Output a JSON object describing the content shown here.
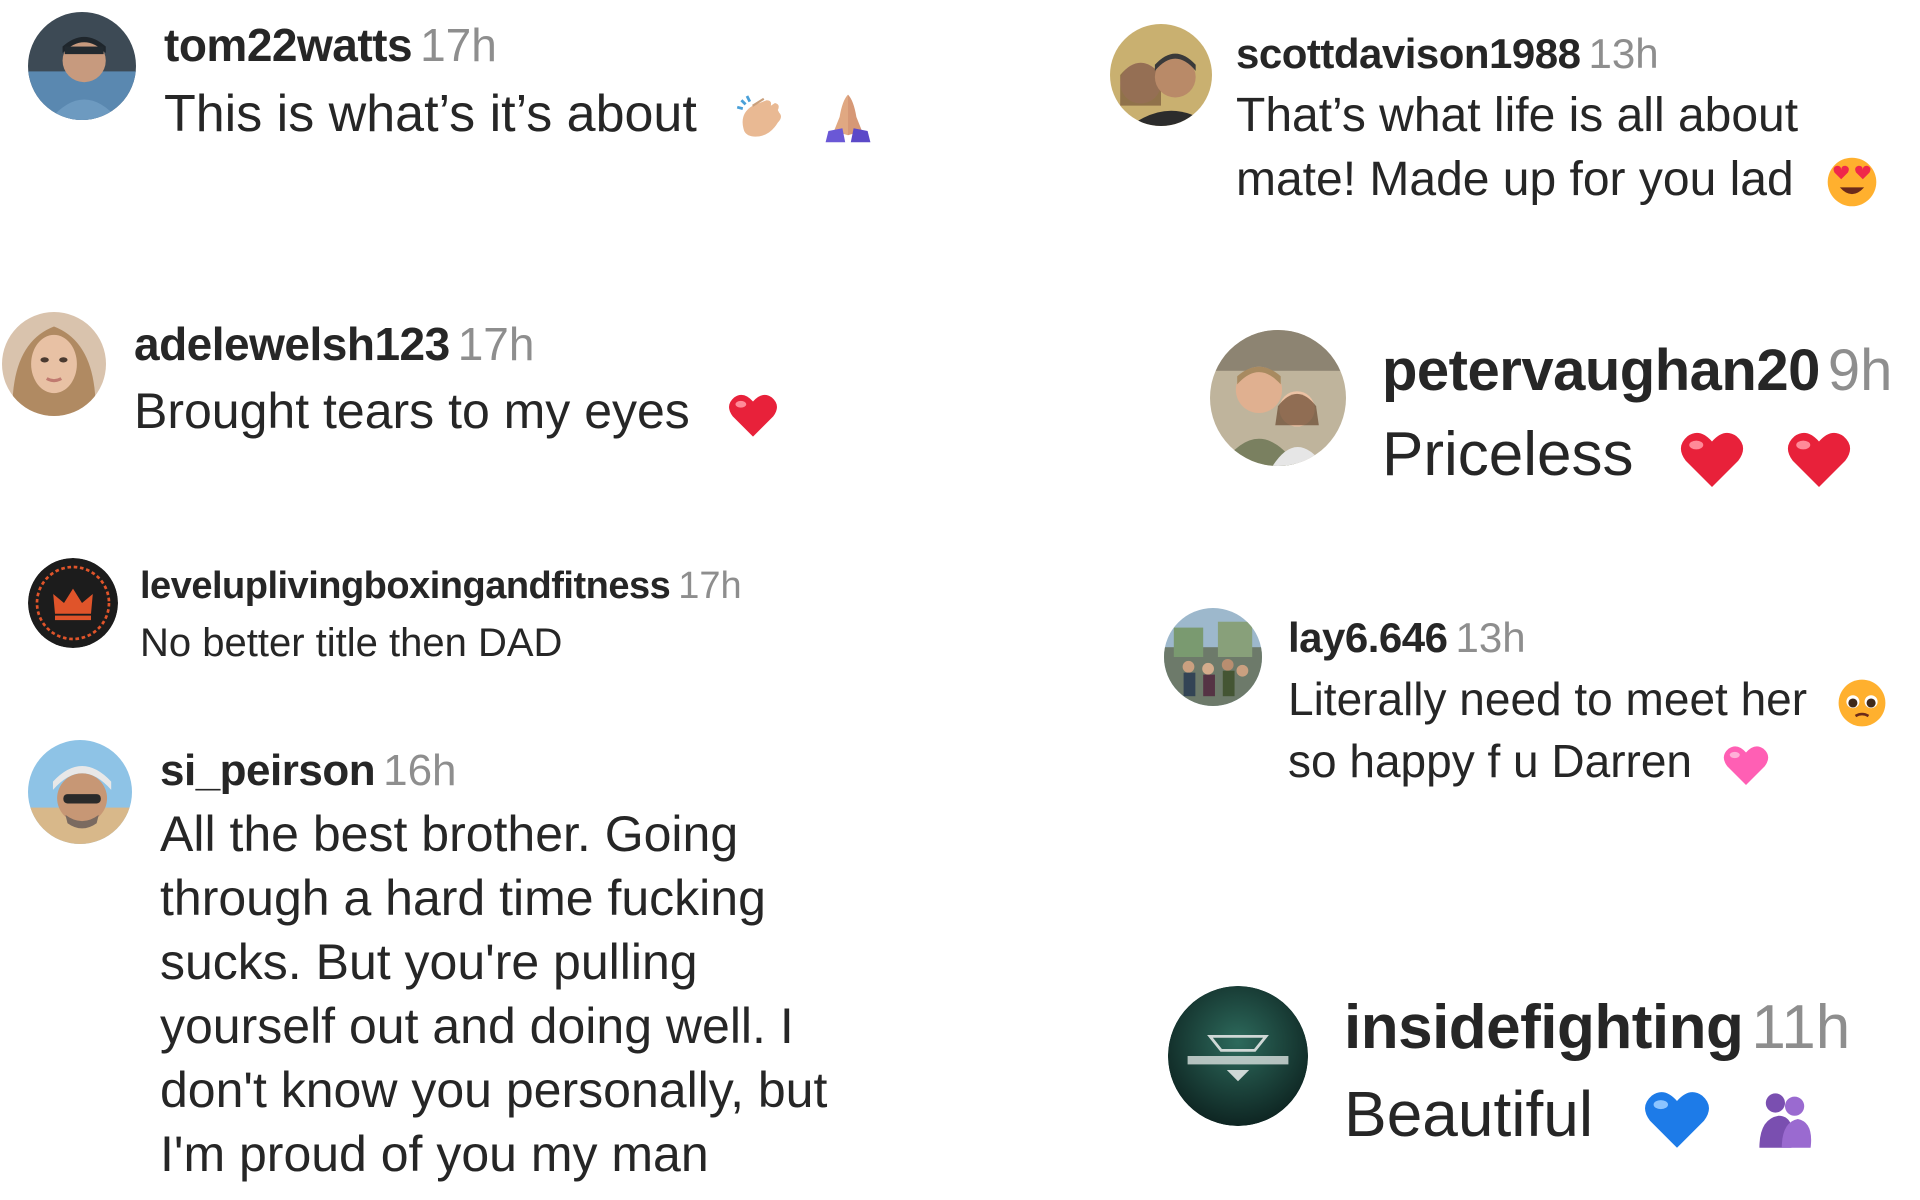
{
  "comments_left": [
    {
      "username": "tom22watts",
      "time": "17h",
      "text": "This is what’s it’s about",
      "emojis": [
        "clapping-hands-icon",
        "folded-hands-icon"
      ]
    },
    {
      "username": "adelewelsh123",
      "time": "17h",
      "text": "Brought tears to my eyes",
      "emojis": [
        "red-heart-icon"
      ]
    },
    {
      "username": "leveluplivingboxingandfitness",
      "time": "17h",
      "text": "No better title then DAD",
      "emojis": []
    },
    {
      "username": "si_peirson",
      "time": "16h",
      "lines": [
        "All the best brother. Going",
        "through a hard time fucking",
        "sucks. But you're pulling",
        "yourself out and doing well. I",
        "don't know you personally, but",
        "I'm proud of you my man"
      ]
    }
  ],
  "comments_right": [
    {
      "username": "scottdavison1988",
      "time": "13h",
      "lines": [
        "That’s what life is all about",
        "mate! Made up for you lad"
      ],
      "emojis": [
        "heart-eyes-face-icon"
      ]
    },
    {
      "username": "petervaughan20",
      "time": "9h",
      "text": "Priceless",
      "emojis": [
        "red-heart-icon",
        "red-heart-icon"
      ]
    },
    {
      "username": "lay6.646",
      "time": "13h",
      "lines": [
        "Literally need to meet her",
        "so happy f u Darren"
      ],
      "emojis": [
        "pleading-face-icon",
        "pink-heart-icon"
      ]
    },
    {
      "username": "insidefighting",
      "time": "11h",
      "text": "Beautiful",
      "emojis": [
        "blue-heart-icon",
        "people-hugging-icon"
      ]
    }
  ],
  "colors": {
    "text": "#262626",
    "timestamp": "#8e8e8e",
    "heart_red": "#e8213a",
    "heart_pink": "#ff5fb4",
    "heart_blue": "#1d7be8"
  }
}
